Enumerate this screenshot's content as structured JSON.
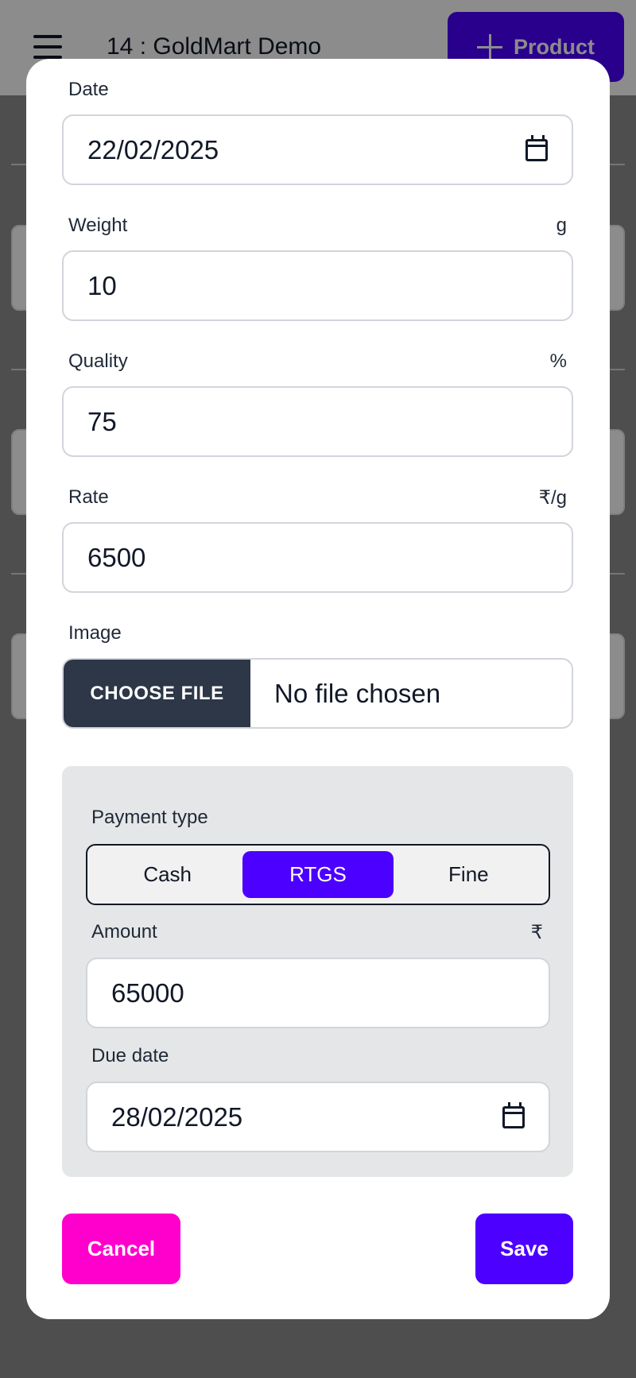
{
  "header": {
    "title": "14 : GoldMart Demo",
    "product_button_label": "Product"
  },
  "form": {
    "date": {
      "label": "Date",
      "value": "22/02/2025"
    },
    "weight": {
      "label": "Weight",
      "unit": "g",
      "value": "10"
    },
    "quality": {
      "label": "Quality",
      "unit": "%",
      "value": "75"
    },
    "rate": {
      "label": "Rate",
      "unit": "₹/g",
      "value": "6500"
    },
    "image": {
      "label": "Image",
      "button_label": "CHOOSE FILE",
      "status": "No file chosen"
    }
  },
  "payment": {
    "type_label": "Payment type",
    "options": [
      "Cash",
      "RTGS",
      "Fine"
    ],
    "selected": "RTGS",
    "amount": {
      "label": "Amount",
      "unit": "₹",
      "value": "65000"
    },
    "due_date": {
      "label": "Due date",
      "value": "28/02/2025"
    }
  },
  "actions": {
    "cancel_label": "Cancel",
    "save_label": "Save"
  },
  "colors": {
    "primary": "#4c00ff",
    "cancel": "#ff00cc",
    "file_button": "#2d3748"
  }
}
